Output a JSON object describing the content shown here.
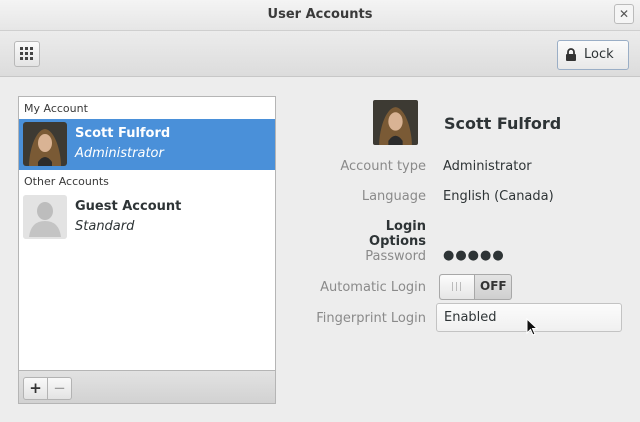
{
  "window": {
    "title": "User Accounts",
    "close_glyph": "✕"
  },
  "toolbar": {
    "lock_label": "Lock"
  },
  "sidebar": {
    "my_account_header": "My Account",
    "other_accounts_header": "Other Accounts",
    "accounts": [
      {
        "name": "Scott Fulford",
        "role": "Administrator",
        "selected": true
      },
      {
        "name": "Guest Account",
        "role": "Standard",
        "selected": false
      }
    ],
    "add_label": "+",
    "remove_label": "−"
  },
  "details": {
    "name": "Scott Fulford",
    "account_type_label": "Account type",
    "account_type_value": "Administrator",
    "language_label": "Language",
    "language_value": "English (Canada)",
    "login_options_heading": "Login Options",
    "password_label": "Password",
    "password_value": "●●●●●",
    "automatic_login_label": "Automatic Login",
    "automatic_login_state": "OFF",
    "fingerprint_label": "Fingerprint Login",
    "fingerprint_value": "Enabled"
  },
  "colors": {
    "selection": "#4a90d9",
    "background": "#ededed"
  }
}
